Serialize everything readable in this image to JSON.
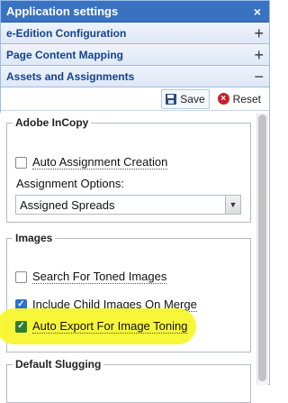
{
  "window": {
    "title": "Application settings"
  },
  "accordion": [
    {
      "label": "e-Edition Configuration",
      "toggle": "+"
    },
    {
      "label": "Page Content Mapping",
      "toggle": "+"
    },
    {
      "label": "Assets and Assignments",
      "toggle": "−"
    }
  ],
  "toolbar": {
    "save_label": "Save",
    "reset_label": "Reset"
  },
  "adobe_incopy": {
    "legend": "Adobe InCopy",
    "auto_assignment": {
      "label": "Auto Assignment Creation",
      "checked": false
    },
    "assignment_options_label": "Assignment Options:",
    "assignment_options_value": "Assigned Spreads"
  },
  "images": {
    "legend": "Images",
    "search_toned": {
      "label": "Search For Toned Images",
      "checked": false
    },
    "include_child": {
      "label": "Include Child Images On Merge",
      "checked": true
    },
    "auto_export": {
      "label": "Auto Export For Image Toning",
      "checked": true
    }
  },
  "default_slugging": {
    "legend": "Default Slugging"
  },
  "colors": {
    "highlight": "#f7f52d",
    "title_bar": "#3a72c2",
    "header_text": "#15428b"
  }
}
